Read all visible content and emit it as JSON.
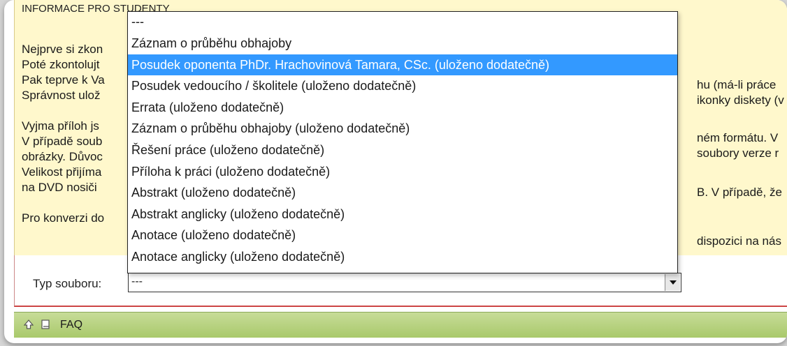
{
  "info": {
    "title": "INFORMACE PRO STUDENTY",
    "lines_left": [
      "Nejprve si zkon",
      "Poté zkontolujt",
      "Pak teprve k Va",
      "Správnost ulož",
      "",
      "Vyjma příloh js",
      "V případě soub",
      "obrázky. Důvoc",
      "Velikost přijíma",
      "na DVD nosiči",
      "",
      "Pro konverzi do"
    ],
    "fragments_right": [
      "hu (má-li práce",
      "ikonky diskety (v",
      "ném formátu. V",
      "soubory verze r",
      "B. V případě, že",
      "dispozici na nás"
    ]
  },
  "form": {
    "type_label": "Typ souboru:",
    "select_value": "---",
    "options": [
      "---",
      "Záznam o průběhu obhajoby",
      "Posudek oponenta PhDr. Hrachovinová Tamara, CSc. (uloženo dodatečně)",
      "Posudek vedoucího / školitele (uloženo dodatečně)",
      "Errata (uloženo dodatečně)",
      "Záznam o průběhu obhajoby (uloženo dodatečně)",
      "Řešení práce (uloženo dodatečně)",
      "Příloha k práci (uloženo dodatečně)",
      "Abstrakt (uloženo dodatečně)",
      "Abstrakt anglicky (uloženo dodatečně)",
      "Anotace (uloženo dodatečně)",
      "Anotace anglicky (uloženo dodatečně)"
    ],
    "highlighted_option": "Posudek oponenta PhDr. Hrachovinová Tamara, CSc. (uloženo dodatečně)"
  },
  "footer": {
    "icons": [
      "up-arrow-icon",
      "book-icon"
    ],
    "faq_label": "FAQ"
  },
  "colors": {
    "info_background": "#fff8cc",
    "highlight": "#3399ff",
    "footer_green": "#b5d07b",
    "form_border": "#cc4444"
  }
}
